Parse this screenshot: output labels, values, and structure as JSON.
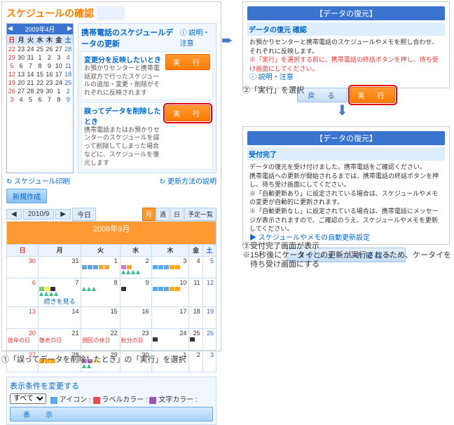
{
  "left": {
    "title": "スケジュールの確認",
    "help": "説明・注意",
    "miniCal": {
      "title": "2009年4月",
      "dow": [
        "日",
        "月",
        "火",
        "水",
        "木",
        "金",
        "土"
      ],
      "grid": [
        [
          "22",
          "23",
          "24",
          "25",
          "26",
          "27",
          "28"
        ],
        [
          "29",
          "30",
          "31",
          "1",
          "2",
          "3",
          "4"
        ],
        [
          "5",
          "6",
          "7",
          "8",
          "9",
          "10",
          "11"
        ],
        [
          "12",
          "13",
          "14",
          "15",
          "16",
          "17",
          "18"
        ],
        [
          "19",
          "20",
          "21",
          "22",
          "23",
          "24",
          "25"
        ],
        [
          "26",
          "27",
          "28",
          "29",
          "30",
          "1",
          "2"
        ],
        [
          "3",
          "4",
          "5",
          "6",
          "7",
          "8",
          "9"
        ]
      ]
    },
    "update": {
      "title": "携帯電話のスケジュールデータの更新",
      "box1": {
        "t": "変更分を反映したいとき",
        "d": "お預かりセンターと携帯電話双方で行ったスケジュールの追加・変更・削除がそれぞれに反映されます",
        "btn": "実　行"
      },
      "box2": {
        "t": "誤ってデータを削除したとき",
        "d": "携帯電話またはお預かりセンターのスケジュールを誤って削除してしまった場合などに、スケジュールを復元します",
        "btn": "実　行"
      }
    },
    "printLink": "スケジュール印刷",
    "refreshLink": "更新方法の説明",
    "newBtn": "新規作成",
    "dateNav": {
      "date": "2010/9",
      "today": "今日"
    },
    "tabs": [
      "月",
      "週",
      "日",
      "予定一覧"
    ],
    "monthTitle": "2009年9月",
    "dow": [
      "日",
      "月",
      "火",
      "水",
      "木",
      "金",
      "土"
    ],
    "days": [
      [
        {
          "n": "30"
        },
        {
          "n": "31"
        },
        {
          "n": "1",
          "ev": [
            "b",
            "b",
            "b",
            "o",
            "o"
          ]
        },
        {
          "n": "2",
          "ev": [
            "p",
            "o"
          ],
          "ev2": [
            "tri",
            "tri",
            "tri",
            "tri"
          ]
        },
        {
          "n": "3",
          "ev": [
            "b",
            "b",
            "b",
            "o",
            "o"
          ]
        },
        {
          "n": "4"
        },
        {
          "n": "5"
        }
      ],
      [
        {
          "n": "6"
        },
        {
          "n": "7",
          "ev": [
            "g",
            "y",
            "k"
          ],
          "ev2": [
            "tri",
            "tri",
            "tri",
            "tri"
          ],
          "more": "続きを見る"
        },
        {
          "n": "8",
          "ev": [
            "tri",
            "tri",
            "tri"
          ]
        },
        {
          "n": "9",
          "ev": [
            "k"
          ]
        },
        {
          "n": "10",
          "ev": [
            "b",
            "b",
            "b",
            "o",
            "o"
          ]
        },
        {
          "n": "11"
        },
        {
          "n": "12"
        }
      ],
      [
        {
          "n": "13"
        },
        {
          "n": "14"
        },
        {
          "n": "15"
        },
        {
          "n": "16"
        },
        {
          "n": "17"
        },
        {
          "n": "18"
        },
        {
          "n": "19"
        }
      ],
      [
        {
          "n": "20",
          "txt": "彼岸の日"
        },
        {
          "n": "21",
          "txt": "敬老の日"
        },
        {
          "n": "22",
          "txt": "国民の休日"
        },
        {
          "n": "23",
          "txt": "秋分の日"
        },
        {
          "n": "24",
          "ev": [
            "k"
          ]
        },
        {
          "n": "25",
          "ev": [
            "k"
          ]
        },
        {
          "n": "26"
        }
      ],
      [
        {
          "n": "27"
        },
        {
          "n": "28",
          "ev": [
            "o",
            "o",
            "o"
          ]
        },
        {
          "n": "29",
          "ev": [
            "p",
            "p",
            "y"
          ],
          "ev2": [
            "tri",
            "tri"
          ]
        },
        {
          "n": "30"
        },
        {
          "n": "1"
        },
        {
          "n": "2"
        },
        {
          "n": "3"
        }
      ]
    ],
    "filters": {
      "title": "表示条件を変更する",
      "all": "すべて",
      "items": [
        {
          "color": "#5da9e6",
          "label": "アイコン :"
        },
        {
          "color": "#e84c50",
          "label": "ラベルカラー :"
        },
        {
          "color": "#9b59b6",
          "label": "文字カラー :"
        }
      ],
      "btn": "表　示"
    }
  },
  "dlg1": {
    "header": "【データの復元】",
    "sub": "データの復元 確認",
    "line1": "お預かりセンターと携帯電話のスケジュールやメモを照し合わせ、それぞれに反映します。",
    "warn": "※「実行」を選択する前に、携帯電話の終話ボタンを押し、待ち受け画面にしてください。",
    "help": "説明・注意",
    "back": "戻　る",
    "go": "実　行"
  },
  "dlg2": {
    "header": "【データの復元】",
    "sub": "受付完了",
    "l1": "データの復元を受け付けました。携帯電話をご確認ください。",
    "l2": "携帯電話への更新が開始されるまでは、携帯電話の終話ボタンを押し、待ち受け画面にしてください。",
    "l3": "※「自動更新あり」に設定されている場合は、スケジュールやメモの変更が自動的に更新されます。",
    "l4": "※「自動更新なし」に設定されている場合は、携帯電話にメッセージが表示されますので、ご確認のうえ、スケジュールやメモを更新してください。",
    "link": "スケジュールやメモの自動更新設定",
    "btn": "スケジュールの確認へ"
  },
  "captions": {
    "c1": "①「誤ってデータを削除したとき」の「実行」を選択",
    "c2": "②「実行」を選択",
    "c3": "③受付完了画面が表示",
    "c4": "※15秒後にケータイとの更新が実行されるため、ケータイを",
    "c5": "　待ち受け画面にする"
  }
}
